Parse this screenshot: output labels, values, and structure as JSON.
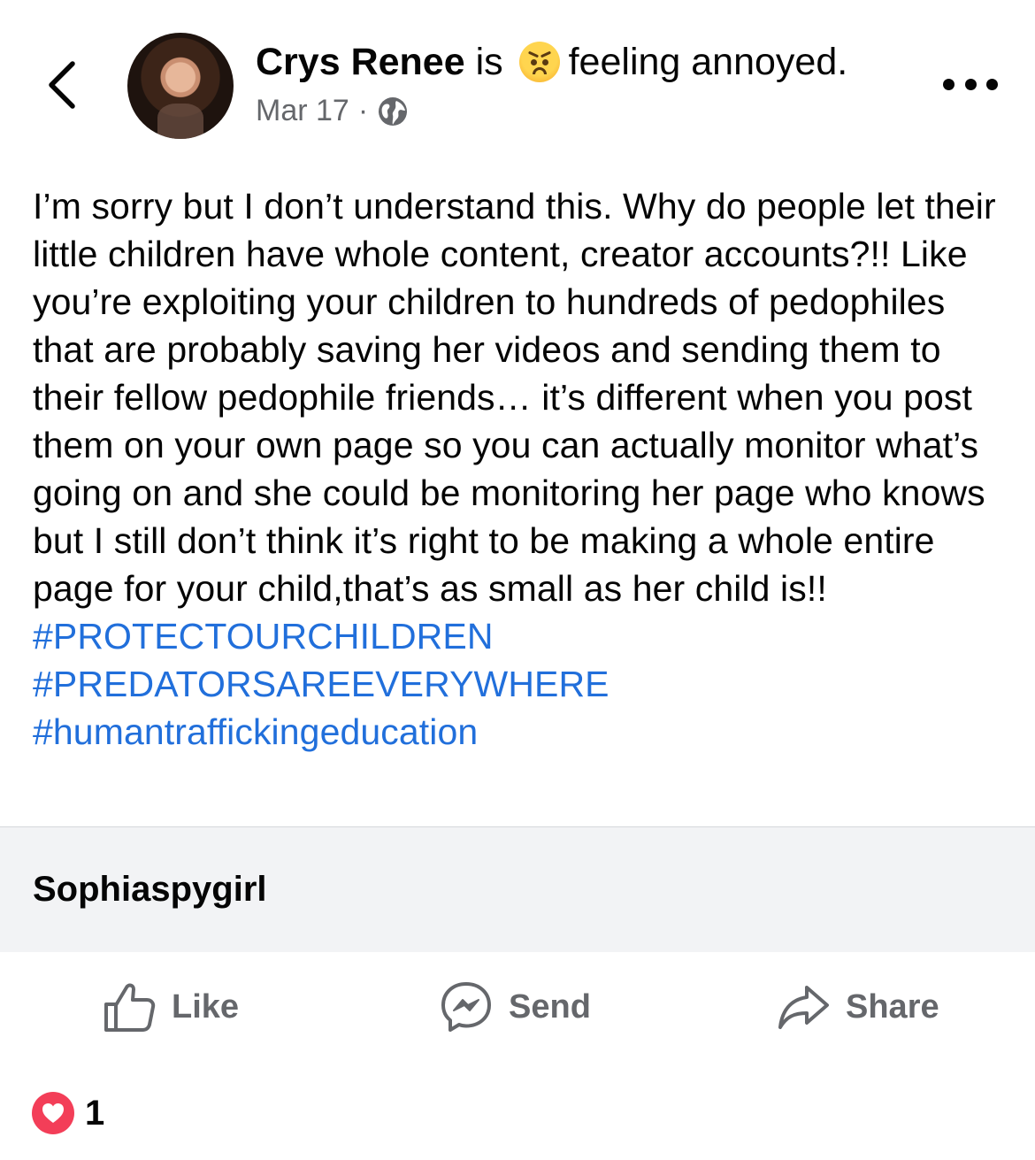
{
  "post": {
    "author": "Crys Renee",
    "verb": "is",
    "feeling": "feeling annoyed.",
    "date": "Mar 17",
    "separator": "·",
    "audience_icon": "globe-icon",
    "mood_icon": "angry-face-emoji",
    "body_text": "I’m sorry but I don’t understand this. Why do people let their little children have whole content, creator accounts?!!  Like you’re exploiting your children to hundreds of pedophiles that are probably saving her videos and sending them to their fellow pedophile friends… it’s different when you post them on your own page so you can actually monitor what’s going on and she could be monitoring her page who knows but I still don’t think it’s right to be making a whole entire page for your child,that’s as small as her child is!! ",
    "hashtags": [
      "#PROTECTOURCHILDREN",
      "#PREDATORSAREEVERYWHERE",
      "#humantraffickingeducation"
    ]
  },
  "link_card": {
    "title": "Sophiaspygirl"
  },
  "actions": {
    "like": "Like",
    "send": "Send",
    "share": "Share"
  },
  "reactions": {
    "icon": "love-reaction-icon",
    "count": "1"
  },
  "colors": {
    "hashtag": "#216fdb",
    "meta_gray": "#65676b",
    "love_red": "#f33e58",
    "card_bg": "#f2f3f5"
  }
}
